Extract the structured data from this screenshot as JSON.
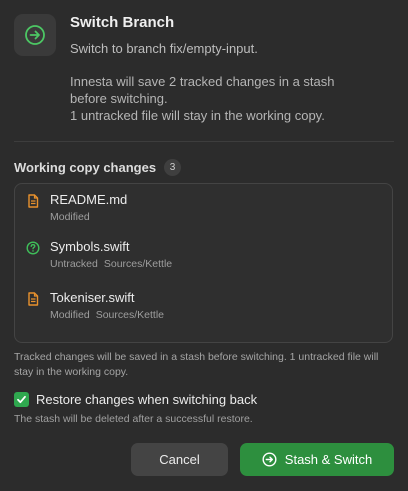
{
  "dialog": {
    "title": "Switch Branch",
    "subtitle": "Switch to branch fix/empty-input.",
    "description_lines": [
      "Innesta will save 2 tracked changes in a stash",
      "before switching.",
      "1 untracked file will stay in the working copy."
    ]
  },
  "changes": {
    "heading": "Working copy changes",
    "count": "3",
    "files": [
      {
        "name": "README.md",
        "status": "Modified",
        "path": "",
        "icon": "modified-file-icon",
        "color": "#e8912d"
      },
      {
        "name": "Symbols.swift",
        "status": "Untracked",
        "path": "Sources/Kettle",
        "icon": "untracked-question-icon",
        "color": "#3fbf5a"
      },
      {
        "name": "Tokeniser.swift",
        "status": "Modified",
        "path": "Sources/Kettle",
        "icon": "modified-file-icon",
        "color": "#e8912d"
      }
    ],
    "note": "Tracked changes will be saved in a stash before switching. 1 untracked file will stay in the working copy."
  },
  "restore": {
    "checked": true,
    "label": "Restore changes when switching back",
    "hint": "The stash will be deleted after a successful restore."
  },
  "buttons": {
    "cancel": "Cancel",
    "confirm": "Stash & Switch"
  },
  "colors": {
    "accent_green": "#2d8f3e",
    "checkbox_green": "#2fa84f",
    "modified_orange": "#e8912d",
    "untracked_green": "#3fbf5a",
    "background": "#2c2c2c"
  }
}
